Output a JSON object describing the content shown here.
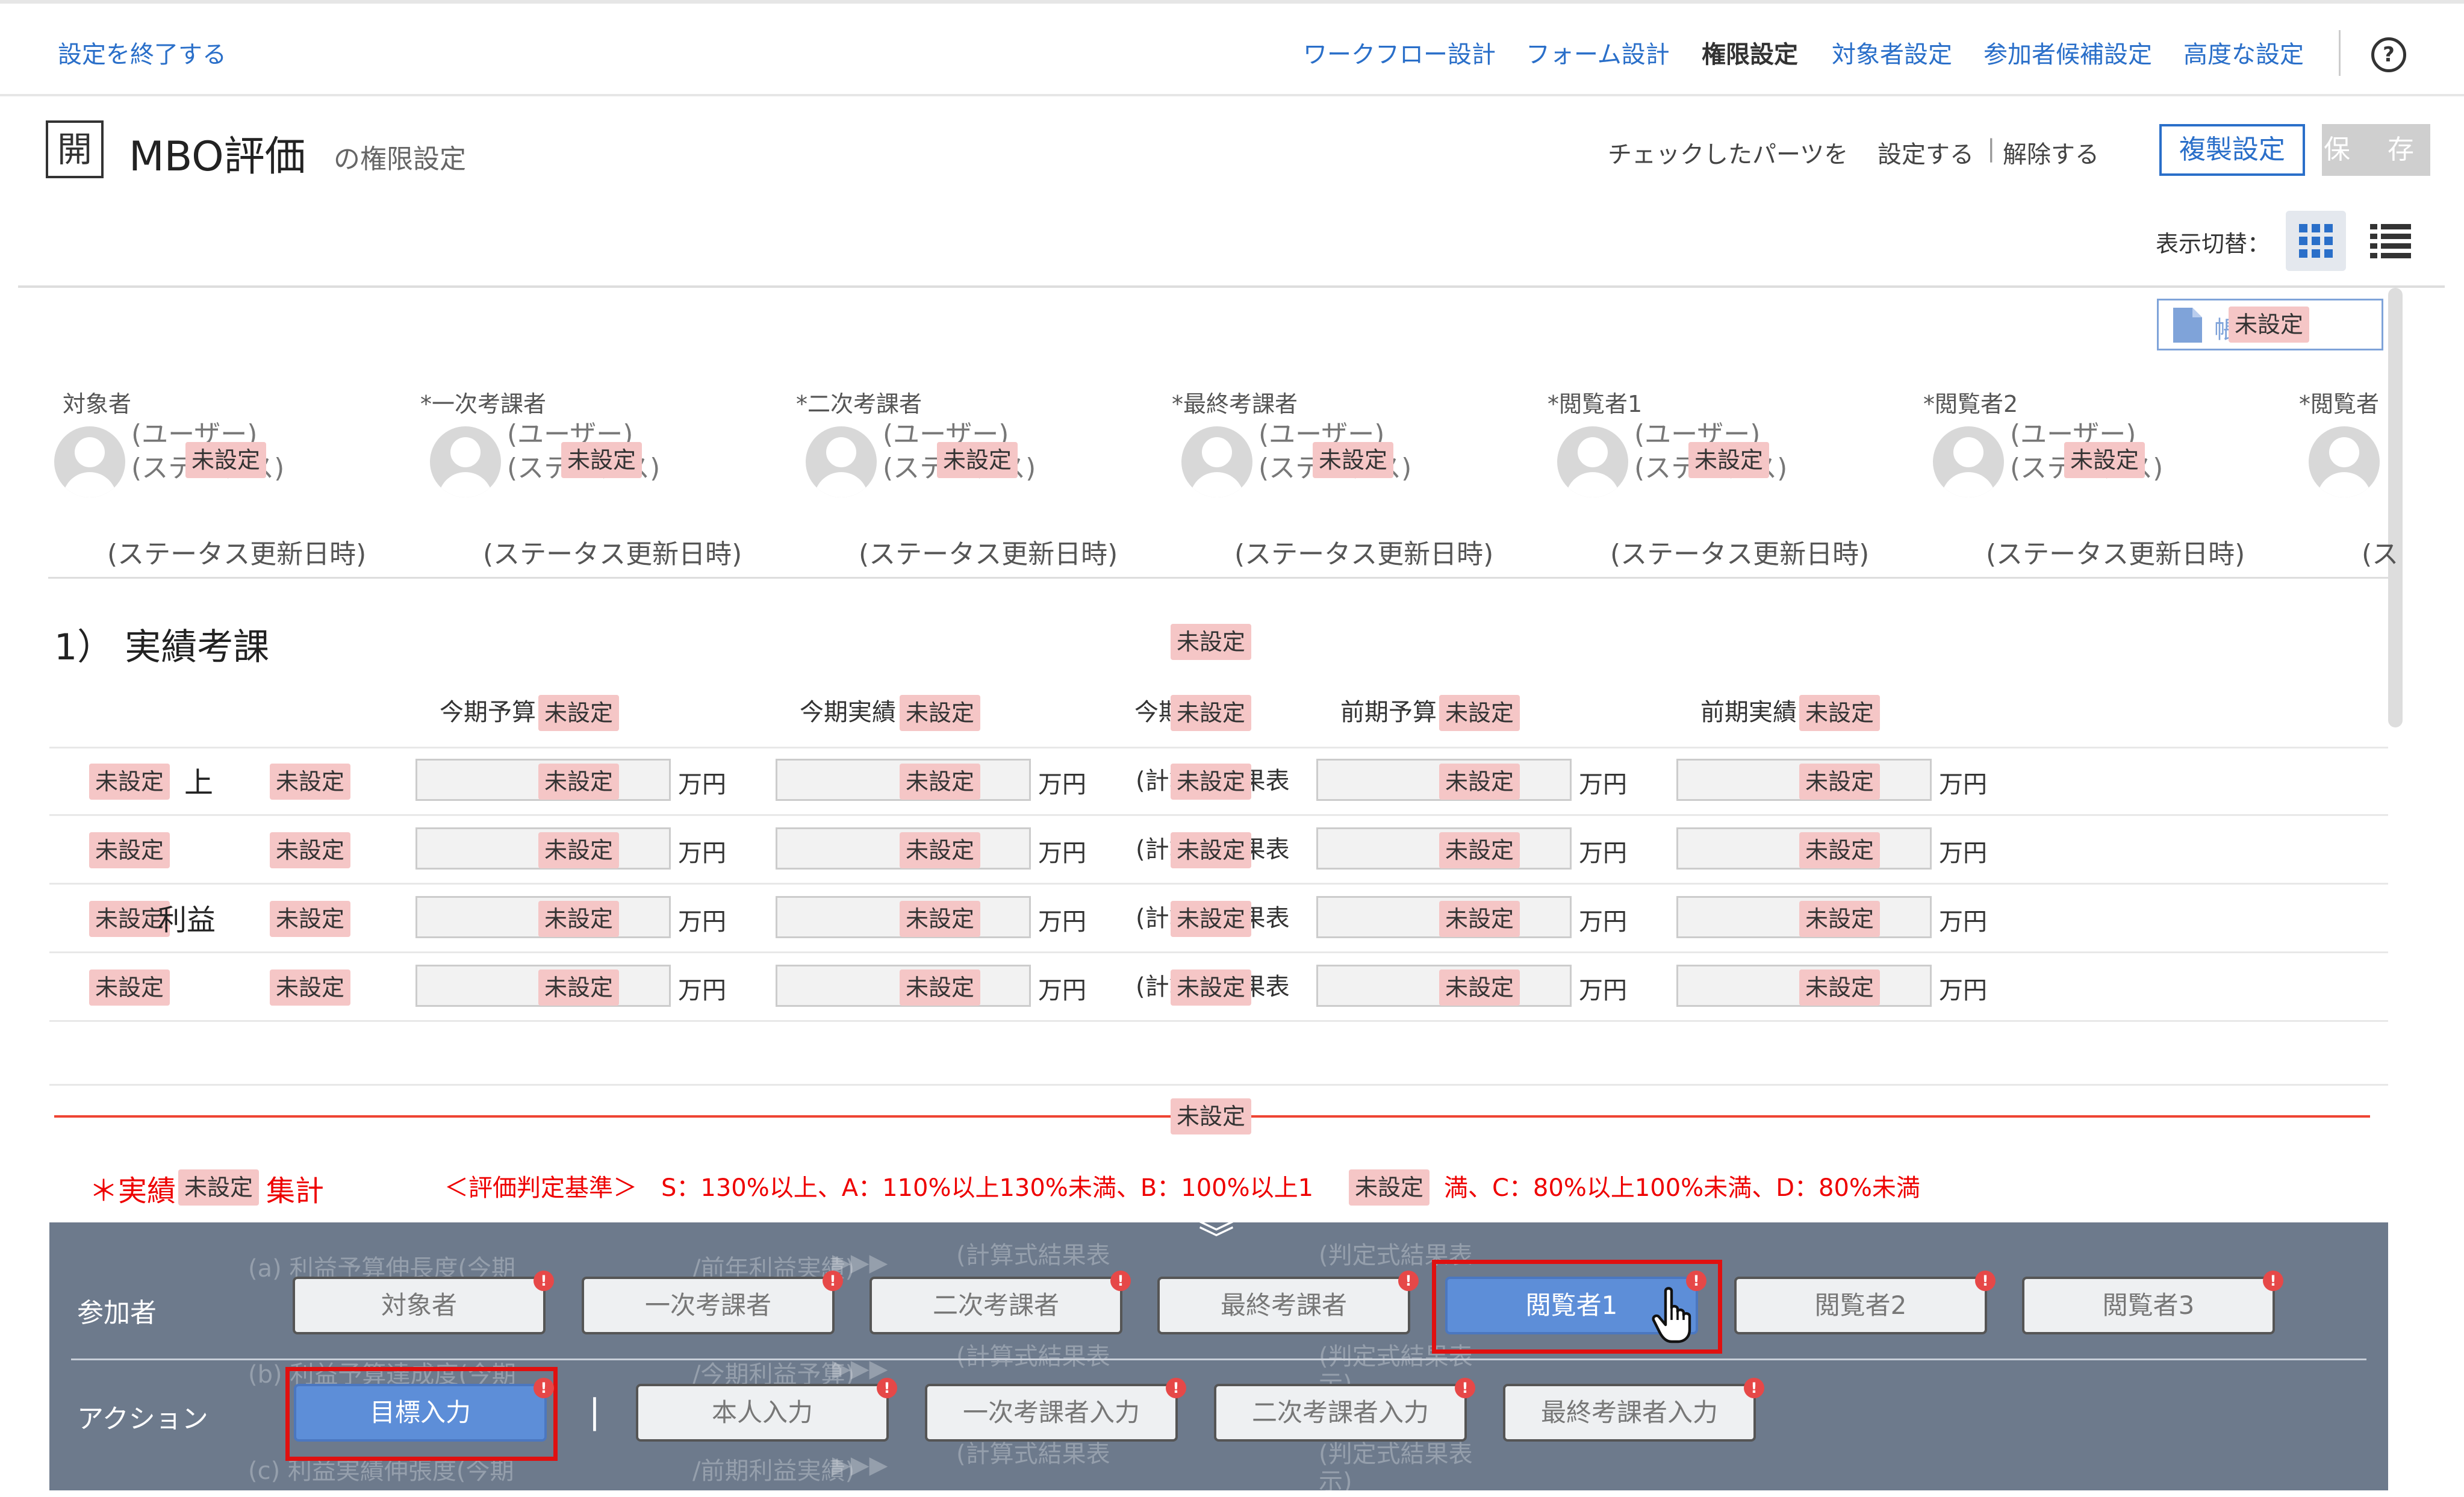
{
  "topbar": {
    "exit": "設定を終了する",
    "nav": [
      "ワークフロー設計",
      "フォーム設計",
      "権限設定",
      "対象者設定",
      "参加者候補設定",
      "高度な設定"
    ],
    "help": "?"
  },
  "header": {
    "icon": "開",
    "title": "MBO評価",
    "subtitle": "の権限設定",
    "checked_parts": "チェックしたパーツを",
    "set": "設定する",
    "sep": "|",
    "unset": "解除する",
    "copy_button": "複製設定",
    "save_button": "保 存",
    "view_switch": "表示切替："
  },
  "common": {
    "unset": "未設定"
  },
  "form": {
    "doc_button": "帳",
    "participants": [
      {
        "label": "対象者",
        "required": false
      },
      {
        "label": "一次考課者",
        "required": true
      },
      {
        "label": "二次考課者",
        "required": true
      },
      {
        "label": "最終考課者",
        "required": true
      },
      {
        "label": "閲覧者1",
        "required": true
      },
      {
        "label": "閲覧者2",
        "required": true
      },
      {
        "label": "閲覧者",
        "required": true
      }
    ],
    "required_mark": "*",
    "user_line1": "(ユーザー)",
    "user_line2": "(ステータス)",
    "status_date": "(ステータス更新日時)",
    "status_date_partial": "(ス",
    "section1_title": "1） 実績考課",
    "columns": [
      "今期予算",
      "今期実績",
      "今期",
      "前期予算",
      "前期実績"
    ],
    "unit": "万円",
    "calc_prefix": "(計",
    "calc_text": "算式結果表",
    "row_tail1": "上",
    "row_tail3": "利益",
    "summary_label_pre": "＊実績",
    "summary_label_post": "集計",
    "criteria": "＜評価判定基準＞　S：130%以上、A：110%以上130%未満、B：100%以上1",
    "criteria_tail": "満、C：80%以上100%未満、D：80%未満"
  },
  "panel": {
    "ghost": {
      "a": "(a) 利益予算伸長度(今期",
      "a2": "/前年利益実績)",
      "b": "(b) 利益予算達成度(今期",
      "b2": "/今期利益予算)",
      "c": "(c) 利益実績伸張度(今期",
      "c2": "/前期利益実績)",
      "arrows": "▶▶▶",
      "calc": "(計算式結果表",
      "judge": "(判定式結果表",
      "disp": "示)"
    },
    "participants_label": "参加者",
    "participants": [
      "対象者",
      "一次考課者",
      "二次考課者",
      "最終考課者",
      "閲覧者1",
      "閲覧者2",
      "閲覧者3"
    ],
    "active_participant": 4,
    "actions_label": "アクション",
    "actions": [
      "目標入力",
      "本人入力",
      "一次考課者入力",
      "二次考課者入力",
      "最終考課者入力"
    ],
    "active_action": 0,
    "divider": "|",
    "collapse": "︾",
    "excl": "!"
  }
}
